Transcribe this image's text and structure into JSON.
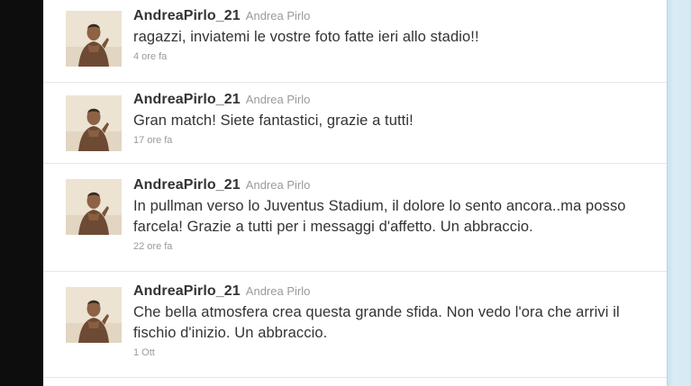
{
  "tweets": [
    {
      "screen_name": "AndreaPirlo_21",
      "full_name": "Andrea Pirlo",
      "text": "ragazzi, inviatemi le vostre foto fatte ieri allo stadio!!",
      "time": "4 ore fa"
    },
    {
      "screen_name": "AndreaPirlo_21",
      "full_name": "Andrea Pirlo",
      "text": "Gran match! Siete fantastici, grazie a tutti!",
      "time": "17 ore fa"
    },
    {
      "screen_name": "AndreaPirlo_21",
      "full_name": "Andrea Pirlo",
      "text": "In pullman verso lo Juventus Stadium, il dolore lo sento ancora..ma posso farcela! Grazie a tutti per i messaggi d'affetto. Un abbraccio.",
      "time": "22 ore fa"
    },
    {
      "screen_name": "AndreaPirlo_21",
      "full_name": "Andrea Pirlo",
      "text": "Che bella atmosfera crea questa grande sfida. Non vedo l'ora che arrivi il fischio d'inizio. Un abbraccio.",
      "time": "1 Ott"
    }
  ]
}
